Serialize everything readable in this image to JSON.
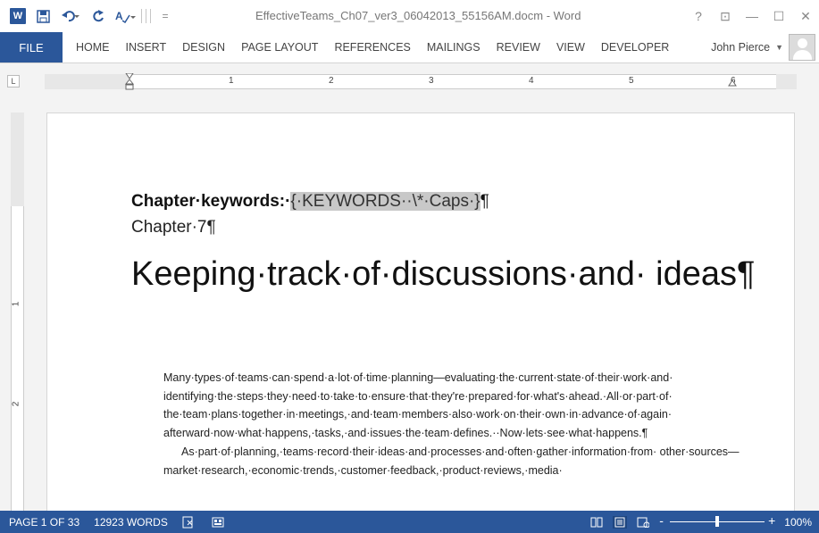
{
  "window": {
    "title": "EffectiveTeams_Ch07_ver3_06042013_55156AM.docm - Word",
    "controls": [
      "?",
      "⊡",
      "—",
      "☐",
      "✕"
    ]
  },
  "qat": {
    "app_icon": "W",
    "save_icon": "save-icon",
    "undo_icon": "undo-icon",
    "redo_icon": "redo-icon",
    "format_painter_icon": "spelling-icon",
    "customize": "="
  },
  "ribbon": {
    "tabs": [
      "FILE",
      "HOME",
      "INSERT",
      "DESIGN",
      "PAGE LAYOUT",
      "REFERENCES",
      "MAILINGS",
      "REVIEW",
      "VIEW",
      "DEVELOPER"
    ],
    "user": "John Pierce"
  },
  "ruler": {
    "tab_selector": "L",
    "numbers": [
      "1",
      "2",
      "3",
      "4",
      "5",
      "6"
    ]
  },
  "vruler": {
    "numbers": [
      "1",
      "2"
    ]
  },
  "document": {
    "keywords_label": "Chapter·keywords:·",
    "keywords_field": "{·KEYWORDS··\\*·Caps·}",
    "keywords_mark": "¶",
    "chapter": "Chapter·7¶",
    "heading": "Keeping·track·of·discussions·and· ideas¶",
    "paragraph1": "Many·types·of·teams·can·spend·a·lot·of·time·planning—evaluating·the·current·state·of·their·work·and· identifying·the·steps·they·need·to·take·to·ensure·that·they're·prepared·for·what's·ahead.·All·or·part·of· the·team·plans·together·in·meetings,·and·team·members·also·work·on·their·own·in·advance·of·again· afterward·now·what·happens,·tasks,·and·issues·the·team·defines.··Now·lets·see·what·happens.¶",
    "paragraph2": "As·part·of·planning,·teams·record·their·ideas·and·processes·and·often·gather·information·from· other·sources—market·research,·economic·trends,·customer·feedback,·product·reviews,·media·"
  },
  "status": {
    "page": "PAGE 1 OF 33",
    "words": "12923 WORDS",
    "proofing_icon": "proofing-icon",
    "macro_icon": "macro-record-icon",
    "views": [
      "read-mode-icon",
      "print-layout-icon",
      "web-layout-icon"
    ],
    "zoom_minus": "-",
    "zoom_plus": "+",
    "zoom": "100%",
    "zoom_level": 0.5
  },
  "colors": {
    "accent": "#2b579a",
    "field_shading": "#c8c8c8"
  }
}
